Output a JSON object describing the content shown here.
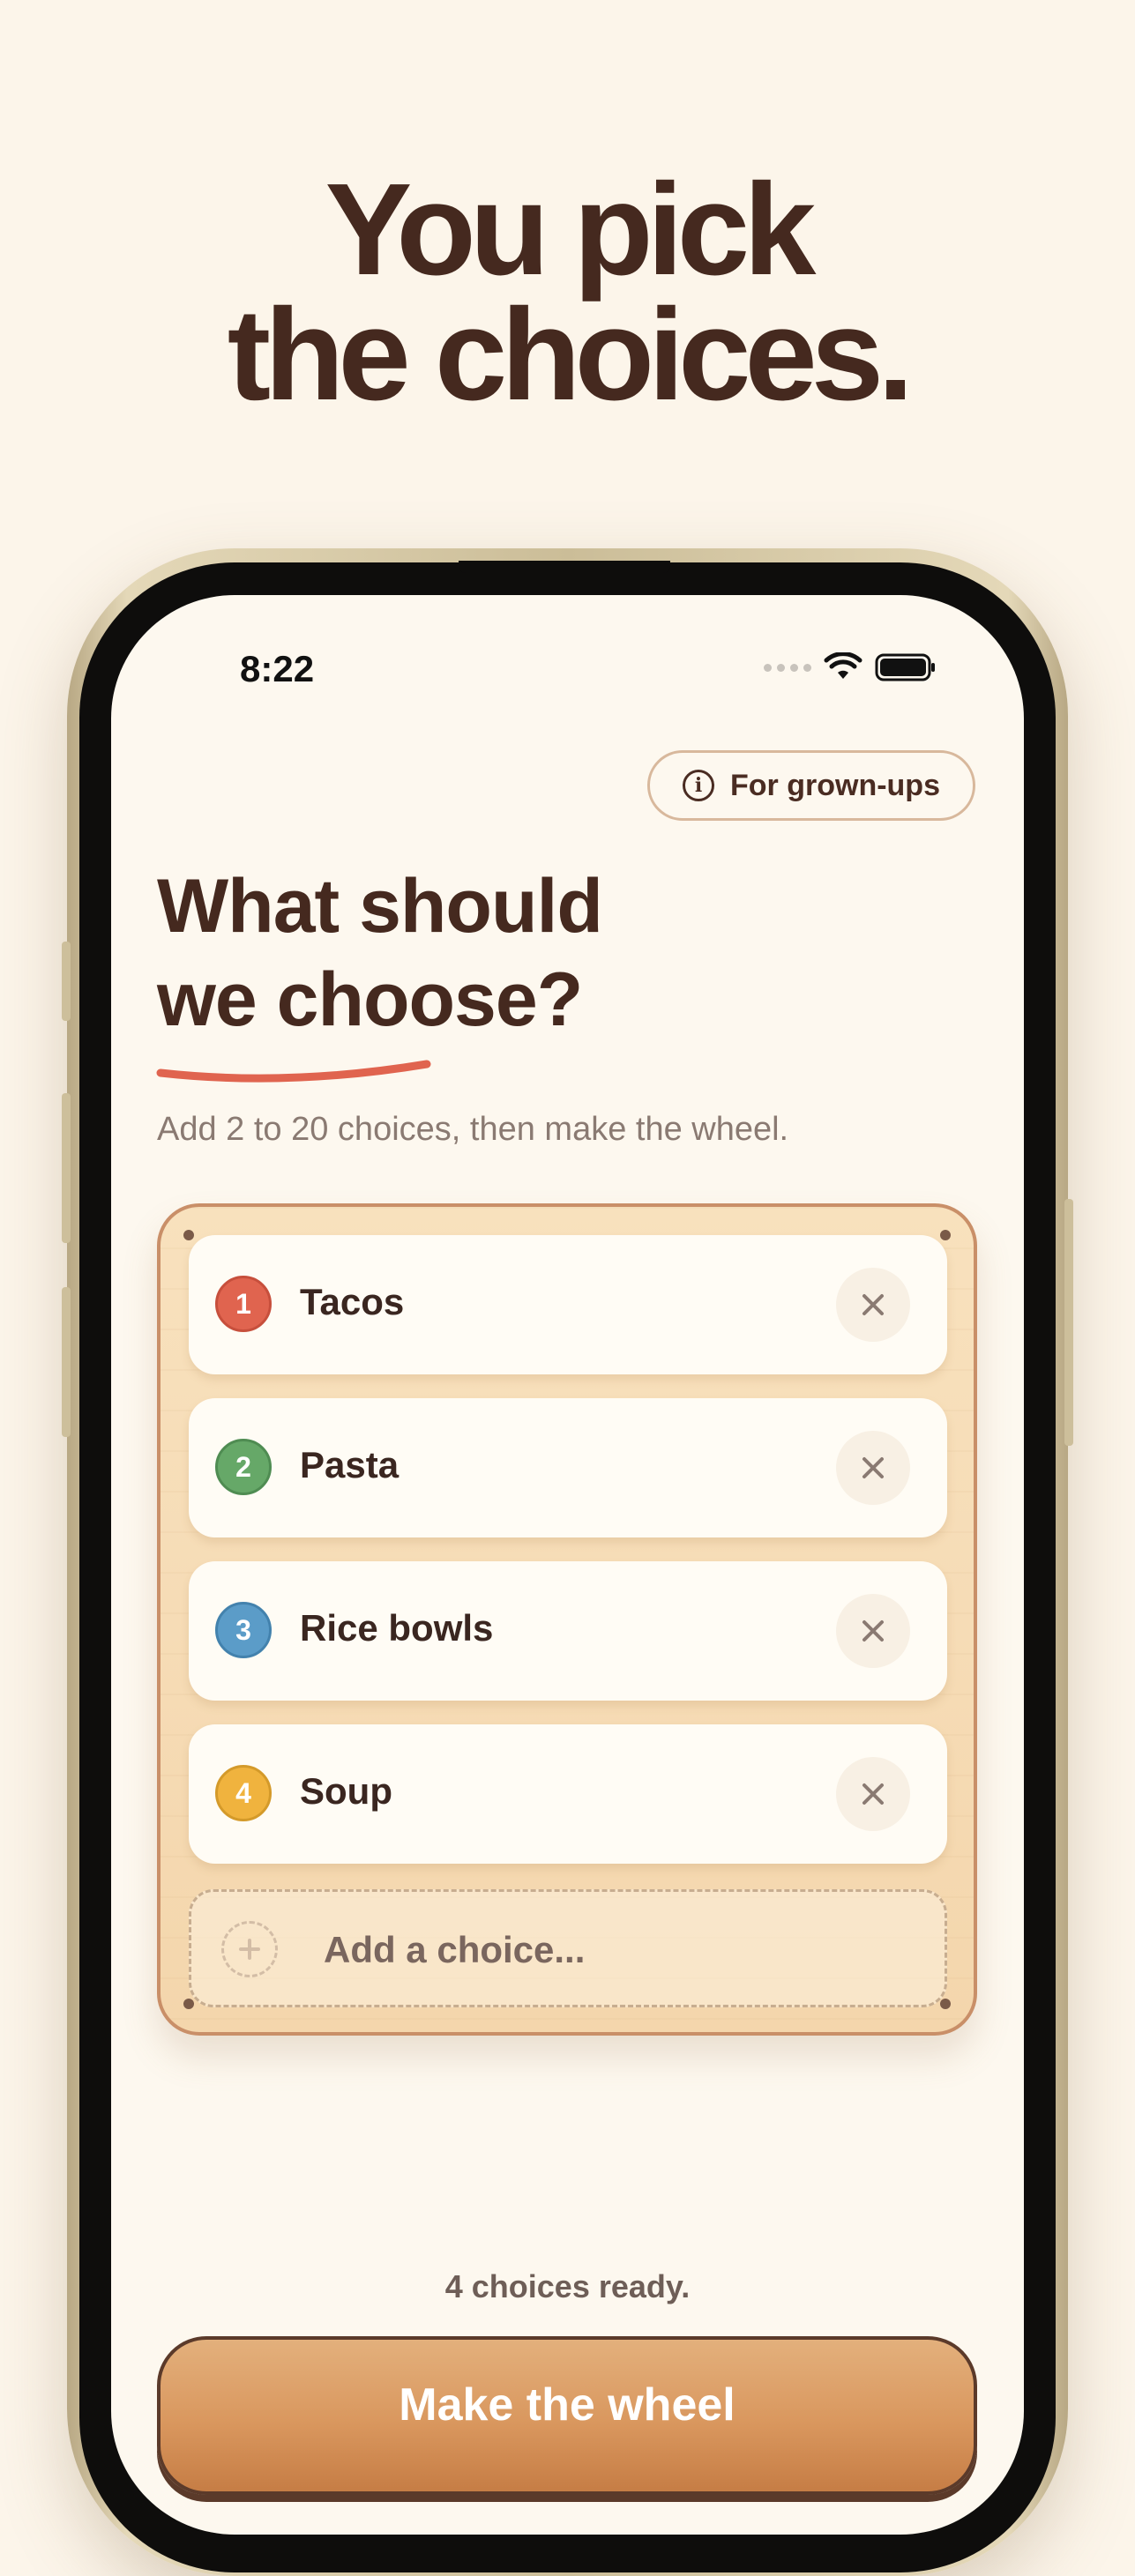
{
  "headline": {
    "line1": "You pick",
    "line2": "the choices."
  },
  "status_bar": {
    "time": "8:22"
  },
  "grownups_button": {
    "label": "For grown-ups"
  },
  "page": {
    "title_line1": "What should",
    "title_line2": "we choose?",
    "subtitle": "Add 2 to 20 choices, then make the wheel."
  },
  "choices": [
    {
      "number": "1",
      "label": "Tacos",
      "color": "#e0644f"
    },
    {
      "number": "2",
      "label": "Pasta",
      "color": "#66a868"
    },
    {
      "number": "3",
      "label": "Rice bowls",
      "color": "#5b9cc8"
    },
    {
      "number": "4",
      "label": "Soup",
      "color": "#f0b33e"
    }
  ],
  "add_choice": {
    "placeholder": "Add a choice..."
  },
  "footer": {
    "ready_text": "4 choices ready.",
    "make_button": "Make the wheel"
  },
  "icons": {
    "info": "info-icon",
    "remove": "close-icon",
    "add": "plus-icon",
    "wifi": "wifi-icon",
    "battery": "battery-icon",
    "signal": "signal-dots-icon"
  },
  "colors": {
    "background": "#fcf5ea",
    "text_dark": "#45291f",
    "accent_underline": "#e0644f",
    "button": "#d9975e"
  }
}
